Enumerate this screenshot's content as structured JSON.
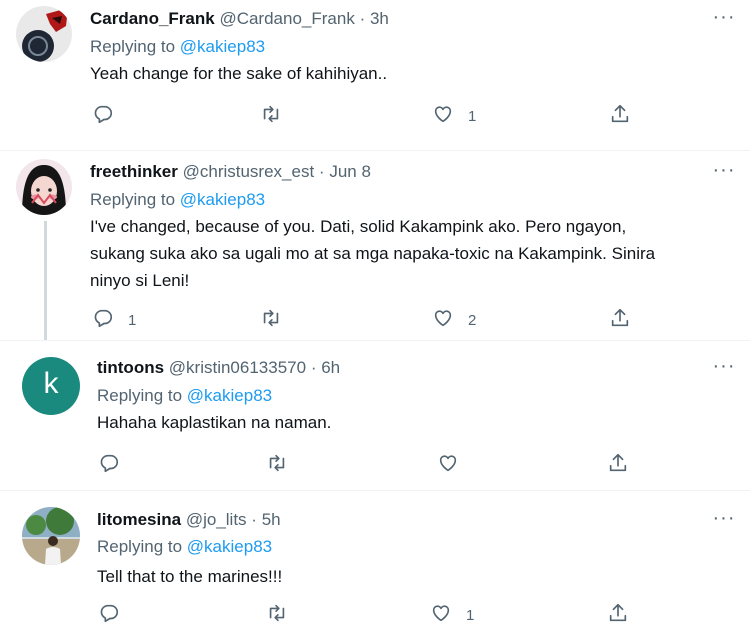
{
  "tweets": [
    {
      "name": "Cardano_Frank",
      "handle": "@Cardano_Frank",
      "separator": "·",
      "time": "3h",
      "replying_prefix": "Replying to",
      "replying_to": "@kakiep83",
      "lines": [
        "Yeah change for the sake of kahihiyan.."
      ],
      "reply_count": "",
      "retweet_count": "",
      "like_count": "1"
    },
    {
      "name": "freethinker",
      "handle": "@christusrex_est",
      "separator": "·",
      "time": "Jun 8",
      "replying_prefix": "Replying to",
      "replying_to": "@kakiep83",
      "lines": [
        "I've changed, because of you. Dati, solid Kakampink ako. Pero ngayon,",
        "sukang suka ako sa ugali mo at sa mga napaka-toxic na Kakampink. Sinira",
        "ninyo si Leni!"
      ],
      "reply_count": "1",
      "retweet_count": "",
      "like_count": "2"
    },
    {
      "name": "tintoons",
      "handle": "@kristin06133570",
      "separator": "·",
      "time": "6h",
      "avatar_letter": "k",
      "replying_prefix": "Replying to",
      "replying_to": "@kakiep83",
      "lines": [
        "Hahaha kaplastikan na naman."
      ],
      "reply_count": "",
      "retweet_count": "",
      "like_count": ""
    },
    {
      "name": "litomesina",
      "handle": "@jo_lits",
      "separator": "·",
      "time": "5h",
      "replying_prefix": "Replying to",
      "replying_to": "@kakiep83",
      "lines": [
        "Tell that to the marines!!!"
      ],
      "reply_count": "",
      "retweet_count": "",
      "like_count": "1"
    }
  ],
  "more_label": "···",
  "colors": {
    "text": "#0f1419",
    "secondary": "#536471",
    "accent": "#1d9bf0",
    "avatar_teal": "#1a8a7e",
    "thread_line": "#cfd9de"
  },
  "icons": [
    "reply-icon",
    "retweet-icon",
    "like-icon",
    "share-icon",
    "more-icon"
  ]
}
